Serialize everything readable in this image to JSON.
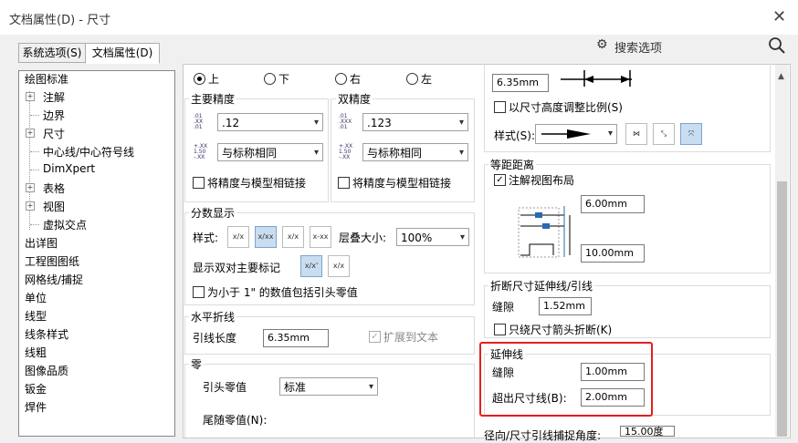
{
  "window": {
    "title": "文档属性(D) - 尺寸",
    "close": "✕"
  },
  "tabs": [
    {
      "label": "系统选项(S)"
    },
    {
      "label": "文档属性(D)"
    }
  ],
  "search": {
    "placeholder": "搜索选项"
  },
  "tree": {
    "items": [
      "绘图标准",
      "注解",
      "边界",
      "尺寸",
      "中心线/中心符号线",
      "DimXpert",
      "表格",
      "视图",
      "虚拟交点",
      "出详图",
      "工程图图纸",
      "网格线/捕捉",
      "单位",
      "线型",
      "线条样式",
      "线粗",
      "图像品质",
      "钣金",
      "焊件"
    ]
  },
  "placement": {
    "options": [
      "上",
      "下",
      "右",
      "左"
    ],
    "selected": "上"
  },
  "primary_precision": {
    "title": "主要精度",
    "value": ".12",
    "tolerance": "与标称相同",
    "link_label": "将精度与模型相链接"
  },
  "dual_precision": {
    "title": "双精度",
    "value": ".123",
    "tolerance": "与标称相同",
    "link_label": "将精度与模型相链接"
  },
  "fraction": {
    "title": "分数显示",
    "style_label": "样式:",
    "stack_label": "层叠大小:",
    "stack_value": "100%",
    "dual_label": "显示双对主要标记",
    "lt1_label": "为小于 1\" 的数值包括引头零值"
  },
  "break": {
    "title": "水平折线",
    "leader_label": "引线长度",
    "leader_value": "6.35mm",
    "extend_label": "扩展到文本"
  },
  "zeros": {
    "title": "零",
    "leading_label": "引头零值",
    "leading_value": "标准",
    "trailing_label": "尾随零值(N):"
  },
  "right": {
    "top_value": "6.35mm",
    "scale_label": "以尺寸高度调整比例(S)",
    "style_label": "样式(S):",
    "offset": {
      "title": "等距距离",
      "use_layout_label": "注解视图布局",
      "v1": "6.00mm",
      "v2": "10.00mm"
    },
    "broken": {
      "title": "折断尺寸延伸线/引线",
      "gap_label": "缝隙",
      "gap_value": "1.52mm",
      "arrow_label": "只绕尺寸箭头折断(K)"
    },
    "ext": {
      "title": "延伸线",
      "gap_label": "缝隙",
      "gap_value": "1.00mm",
      "beyond_label": "超出尺寸线(B):",
      "beyond_value": "2.00mm"
    },
    "radial": {
      "label": "径向/尺寸引线捕捉角度:",
      "value": "15.00度"
    }
  },
  "colors": {
    "highlight": "#e32020",
    "active_btn": "#c9ddf0"
  }
}
